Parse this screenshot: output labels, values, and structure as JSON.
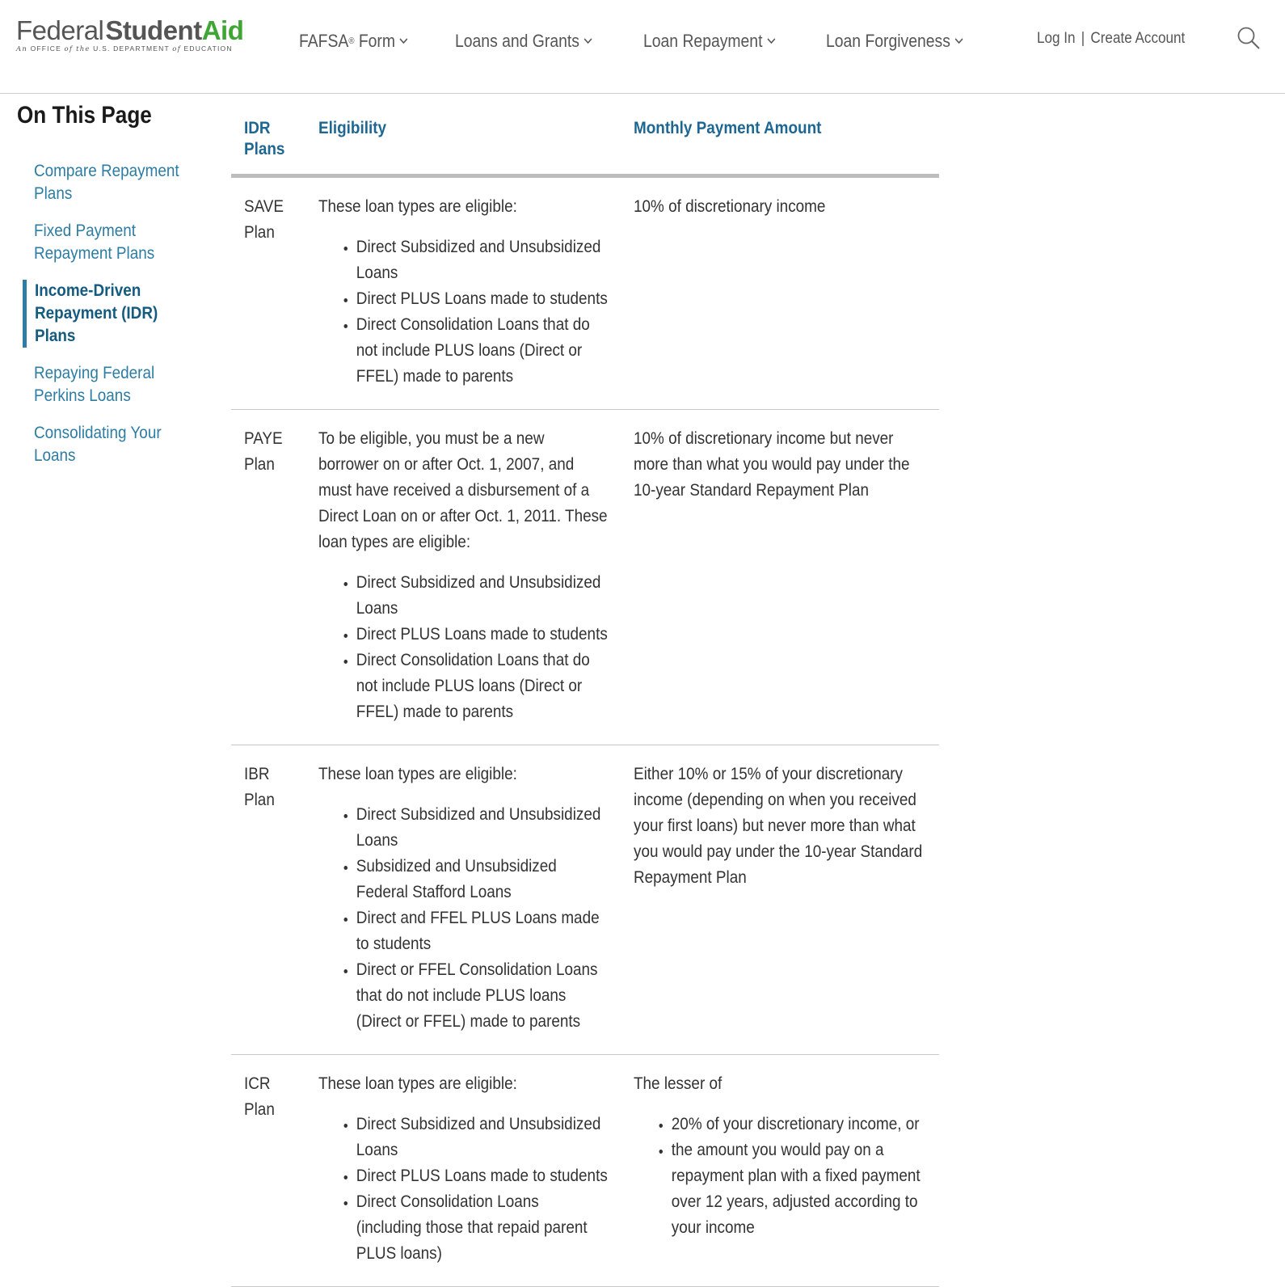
{
  "header": {
    "logo": {
      "federal": "Federal",
      "student": "Student",
      "aid": "Aid",
      "tagline_parts": [
        "An",
        "OFFICE",
        "of the",
        "U.S. DEPARTMENT",
        "of",
        "EDUCATION"
      ]
    },
    "nav": [
      {
        "label": "FAFSA",
        "sup": "®",
        "suffix": " Form",
        "icon": "chevron-down-icon"
      },
      {
        "label": "Loans and Grants",
        "sup": "",
        "suffix": "",
        "icon": "chevron-down-icon"
      },
      {
        "label": "Loan Repayment",
        "sup": "",
        "suffix": "",
        "icon": "chevron-down-icon"
      },
      {
        "label": "Loan Forgiveness",
        "sup": "",
        "suffix": "",
        "icon": "chevron-down-icon"
      }
    ],
    "auth": {
      "login": "Log In",
      "separator": "|",
      "create": "Create Account"
    },
    "search_icon": "search-icon"
  },
  "sidebar": {
    "title": "On This Page",
    "items": [
      {
        "label": "Compare Repayment\nPlans",
        "active": false
      },
      {
        "label": "Fixed Payment\nRepayment Plans",
        "active": false
      },
      {
        "label": "Income-Driven\nRepayment (IDR) Plans",
        "active": true
      },
      {
        "label": "Repaying Federal\nPerkins Loans",
        "active": false
      },
      {
        "label": "Consolidating Your\nLoans",
        "active": false
      }
    ]
  },
  "table": {
    "headers": {
      "plan": "IDR Plans",
      "eligibility": "Eligibility",
      "payment": "Monthly Payment Amount"
    },
    "rows": [
      {
        "plan": "SAVE Plan",
        "elig_intro": "These loan types are eligible:",
        "elig_items": [
          "Direct Subsidized and Unsubsidized Loans",
          "Direct PLUS Loans made to students",
          "Direct Consolidation Loans that do not include PLUS loans (Direct or FFEL) made to parents"
        ],
        "pay_intro": "10% of discretionary income",
        "pay_items": []
      },
      {
        "plan": "PAYE Plan",
        "elig_intro": "To be eligible, you must be a new borrower on or after Oct. 1, 2007, and must have received a disbursement of a Direct Loan on or after Oct. 1, 2011. These loan types are eligible:",
        "elig_items": [
          "Direct Subsidized and Unsubsidized Loans",
          "Direct PLUS Loans made to students",
          "Direct Consolidation Loans that do not include PLUS loans (Direct or FFEL) made to parents"
        ],
        "pay_intro": "10% of discretionary income but never more than what you would pay under the 10-year Standard Repayment Plan",
        "pay_items": []
      },
      {
        "plan": "IBR Plan",
        "elig_intro": "These loan types are eligible:",
        "elig_items": [
          "Direct Subsidized and Unsubsidized Loans",
          "Subsidized and Unsubsidized Federal Stafford Loans",
          "Direct and FFEL PLUS Loans made to students",
          "Direct or FFEL Consolidation Loans that do not include PLUS loans (Direct or FFEL) made to parents"
        ],
        "pay_intro": "Either 10% or 15% of your discretionary income (depending on when you received your first loans) but never more than what you would pay under the 10-year Standard Repayment Plan",
        "pay_items": []
      },
      {
        "plan": "ICR Plan",
        "elig_intro": "These loan types are eligible:",
        "elig_items": [
          "Direct Subsidized and Unsubsidized Loans",
          "Direct PLUS Loans made to students",
          "Direct Consolidation Loans (including those that repaid parent PLUS loans)"
        ],
        "pay_intro": "The lesser of",
        "pay_items": [
          "20% of your discretionary income, or",
          "the amount you would pay on a repayment plan with a fixed payment over 12 years, adjusted according to your income"
        ]
      }
    ]
  },
  "colors": {
    "link": "#2c7ca3",
    "active": "#155b80",
    "header_text": "#1e6792",
    "aid_green": "#3fa535"
  }
}
